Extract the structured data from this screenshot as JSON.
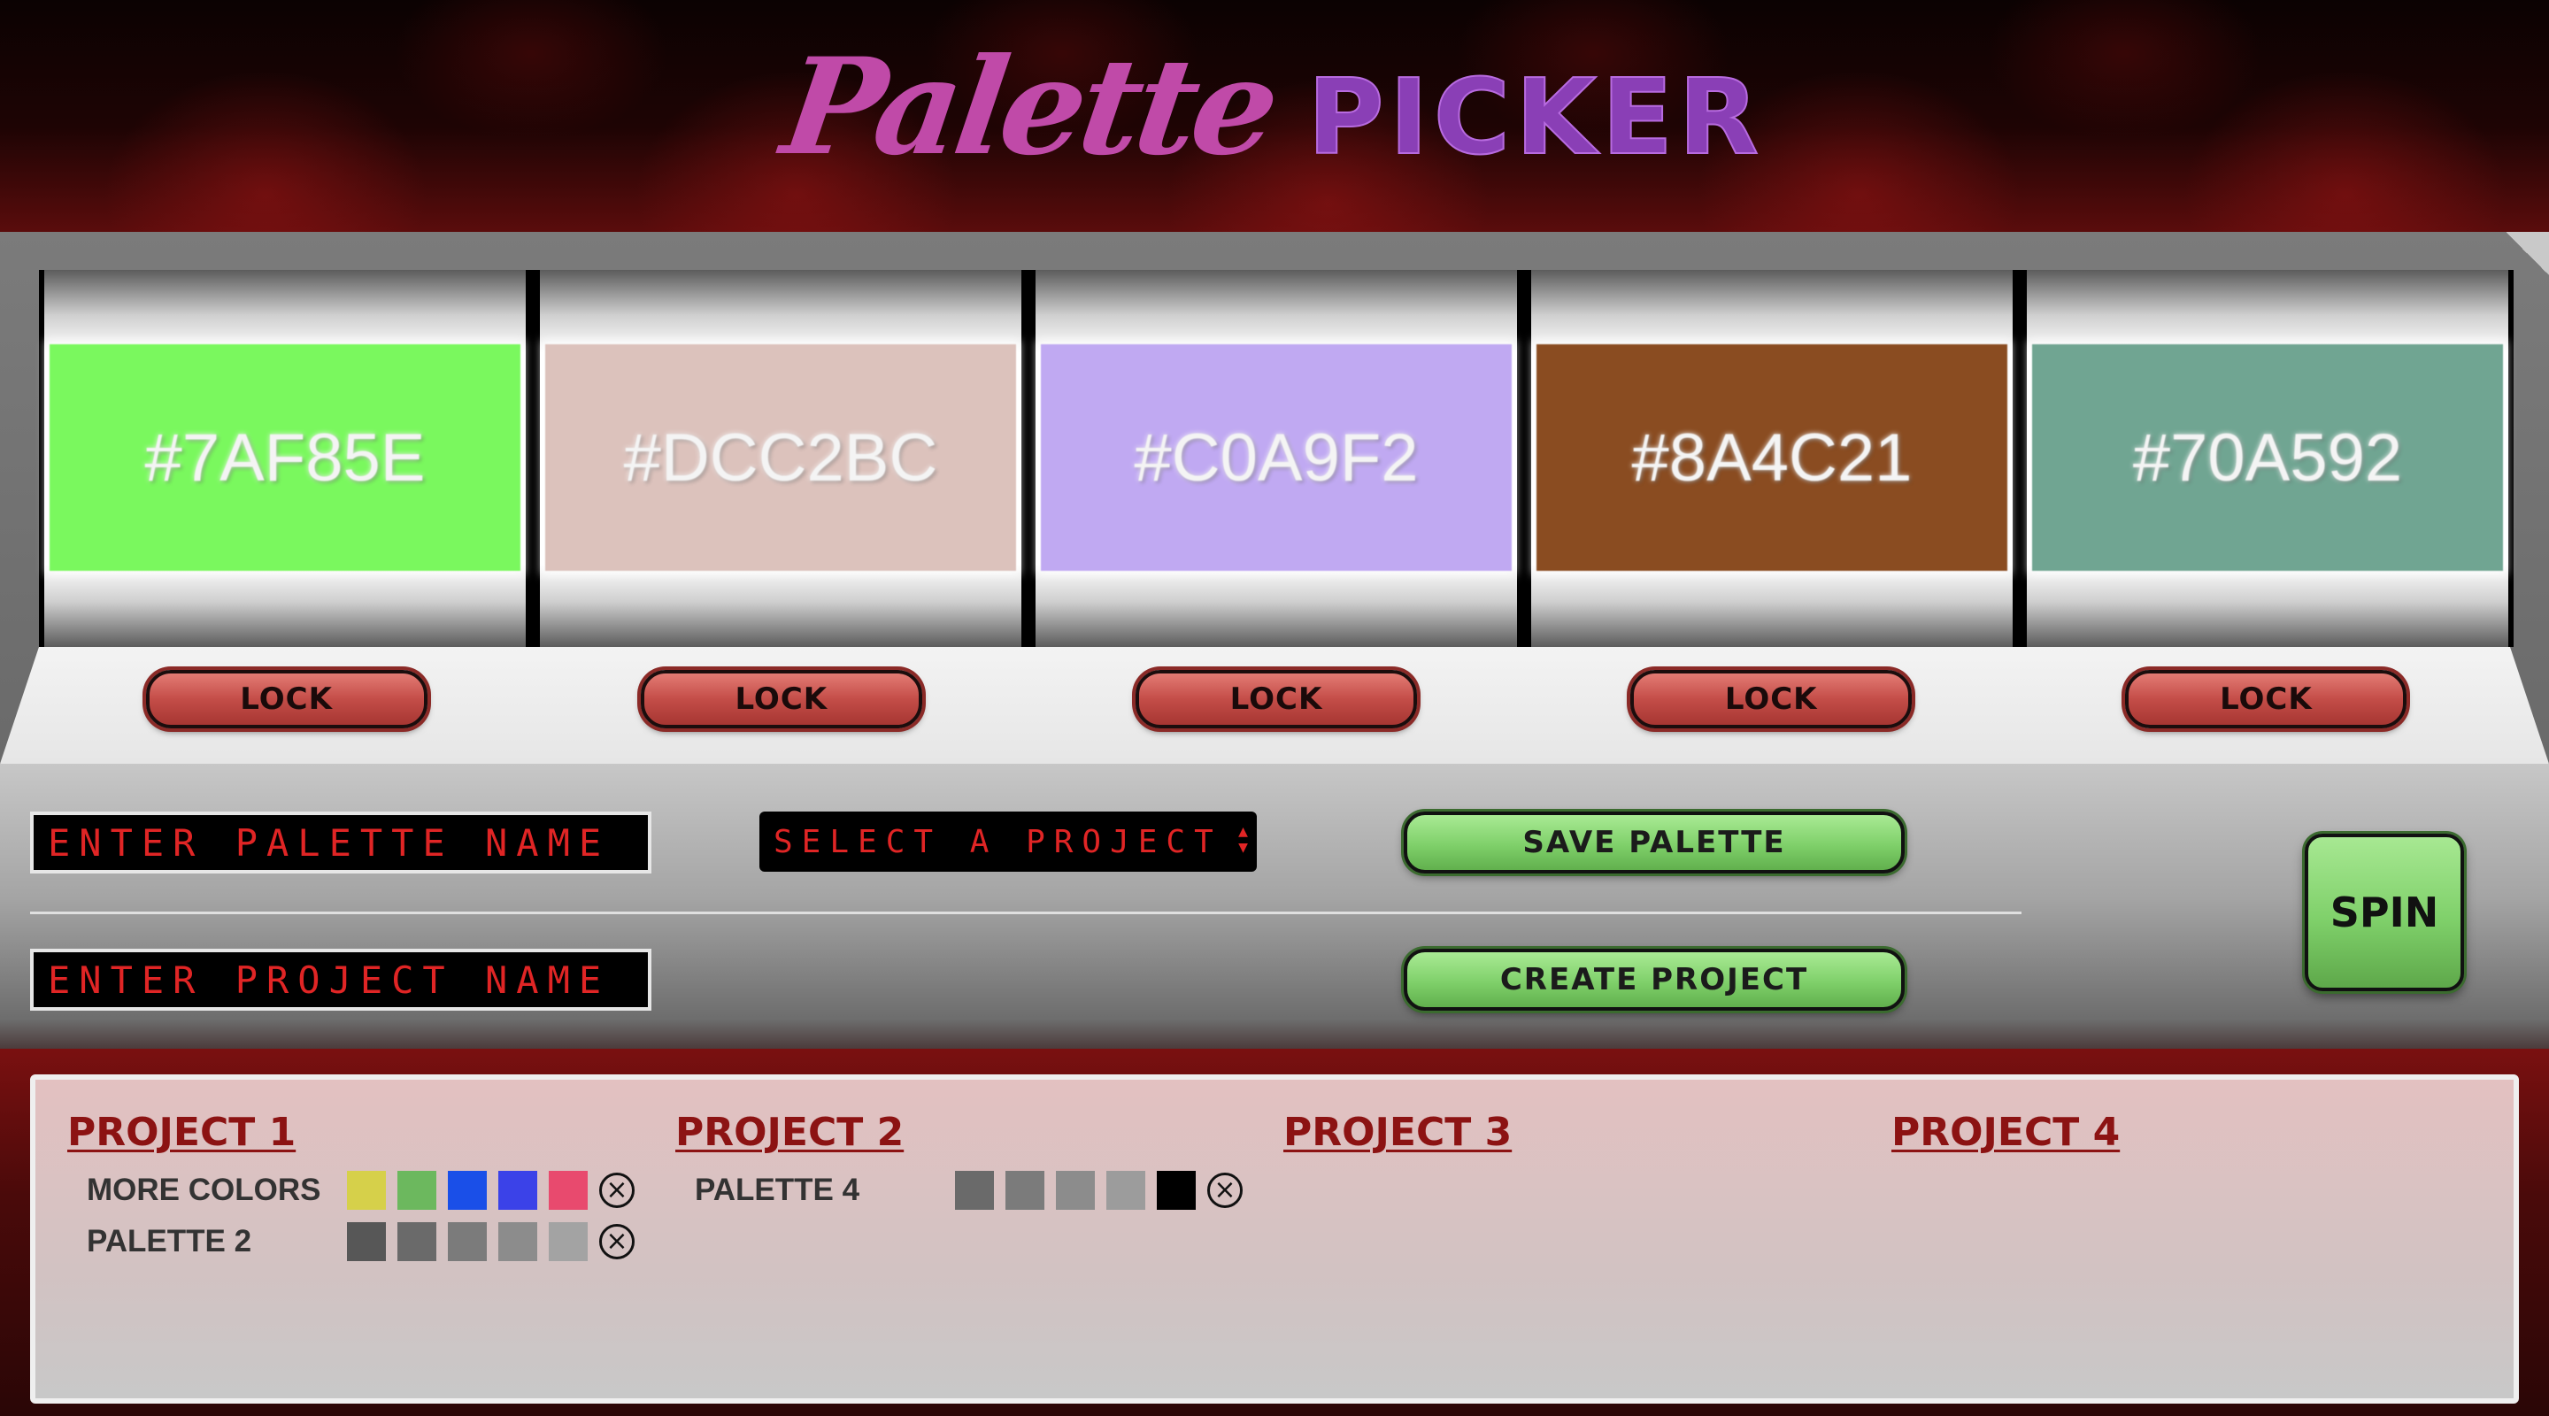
{
  "app": {
    "title_script": "Palette",
    "title_block": "PICKER",
    "title_script_color": "#C04AA8",
    "title_block_color": "#8A3FB6"
  },
  "reels": [
    {
      "hex": "#7AF85E",
      "lock_label": "LOCK"
    },
    {
      "hex": "#DCC2BC",
      "lock_label": "LOCK"
    },
    {
      "hex": "#C0A9F2",
      "lock_label": "LOCK"
    },
    {
      "hex": "#8A4C21",
      "lock_label": "LOCK"
    },
    {
      "hex": "#70A592",
      "lock_label": "LOCK"
    }
  ],
  "controls": {
    "palette_name_placeholder": "ENTER PALETTE NAME",
    "project_select_value": "SELECT A PROJECT",
    "project_name_placeholder": "ENTER PROJECT NAME",
    "save_palette_label": "SAVE PALETTE",
    "create_project_label": "CREATE PROJECT",
    "spin_label": "SPIN"
  },
  "projects": [
    {
      "title": "PROJECT 1",
      "palettes": [
        {
          "name": "MORE COLORS",
          "colors": [
            "#D6D04A",
            "#6CB85E",
            "#1A4FE8",
            "#3B42E8",
            "#E84A6E"
          ]
        },
        {
          "name": "PALETTE 2",
          "colors": [
            "#575757",
            "#6A6A6A",
            "#7B7B7B",
            "#8C8C8C",
            "#A3A3A3"
          ]
        }
      ]
    },
    {
      "title": "PROJECT 2",
      "palettes": [
        {
          "name": "PALETTE 4",
          "colors": [
            "#6A6A6A",
            "#7B7B7B",
            "#8C8C8C",
            "#9C9C9C",
            "#000000"
          ]
        }
      ]
    },
    {
      "title": "PROJECT 3",
      "palettes": []
    },
    {
      "title": "PROJECT 4",
      "palettes": []
    }
  ],
  "icons": {
    "remove": "circle-x-icon",
    "select_arrows": "updown-arrows-icon"
  }
}
